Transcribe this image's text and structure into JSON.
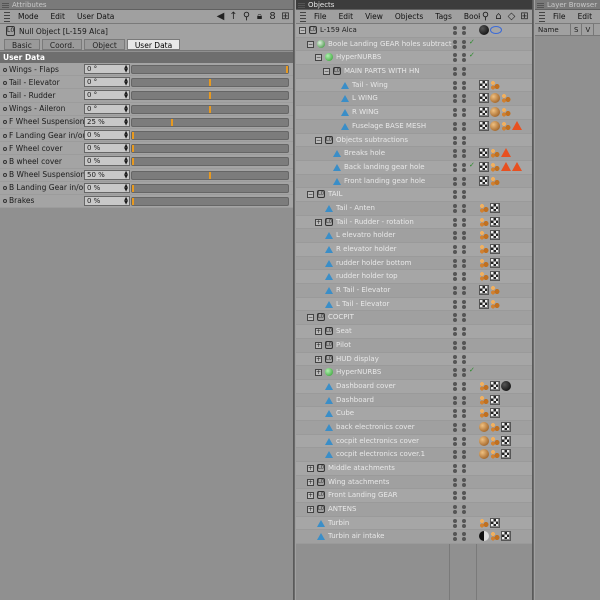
{
  "attributes": {
    "title": "Attributes",
    "menu": [
      "Mode",
      "Edit",
      "User Data"
    ],
    "object_title": "Null Object [L-159 Alca]",
    "tabs": [
      {
        "label": "Basic",
        "active": false
      },
      {
        "label": "Coord.",
        "active": false
      },
      {
        "label": "Object",
        "active": false
      },
      {
        "label": "User Data",
        "active": true
      }
    ],
    "section": "User Data",
    "rows": [
      {
        "label": "Wings - Flaps",
        "value": "0 °",
        "level": 1.0
      },
      {
        "label": "Tail - Elevator",
        "value": "0 °",
        "level": 0.5
      },
      {
        "label": "Tail - Rudder",
        "value": "0 °",
        "level": 0.5
      },
      {
        "label": "Wings - Aileron",
        "value": "0 °",
        "level": 0.5
      },
      {
        "label": "F Wheel Suspension",
        "value": "25 %",
        "level": 0.25
      },
      {
        "label": "F Landing Gear in/out",
        "value": "0 %",
        "level": 0.0
      },
      {
        "label": "F Wheel cover",
        "value": "0 %",
        "level": 0.0
      },
      {
        "label": "B wheel cover",
        "value": "0 %",
        "level": 0.0
      },
      {
        "label": "B Wheel Suspension",
        "value": "50 %",
        "level": 0.5
      },
      {
        "label": "B Landing Gear in/out",
        "value": "0 %",
        "level": 0.0
      },
      {
        "label": "Brakes",
        "value": "0 %",
        "level": 0.0
      }
    ],
    "colors": {
      "slider_marker": "#e89a20"
    }
  },
  "objects": {
    "title": "Objects",
    "menu": [
      "File",
      "Edit",
      "View",
      "Objects",
      "Tags",
      "Bookm"
    ],
    "rows": [
      {
        "name": "L-159 Alca",
        "depth": 0,
        "icon": "null",
        "expand": "-",
        "dim": false,
        "check": false,
        "tags": [
          "sphere",
          "target"
        ]
      },
      {
        "name": "Boole Landing GEAR holes subtract",
        "depth": 1,
        "icon": "boole",
        "expand": "-",
        "dim": true,
        "check": true,
        "tags": []
      },
      {
        "name": "HyperNURBS",
        "depth": 2,
        "icon": "hyper",
        "expand": "-",
        "dim": true,
        "check": true,
        "tags": []
      },
      {
        "name": "MAIN PARTS WITH HN",
        "depth": 3,
        "icon": "null",
        "expand": "-",
        "dim": true,
        "check": false,
        "tags": []
      },
      {
        "name": "Tail - Wing",
        "depth": 4,
        "icon": "tri",
        "expand": "",
        "dim": true,
        "check": false,
        "tags": [
          "checker",
          "phong"
        ]
      },
      {
        "name": "L WING",
        "depth": 4,
        "icon": "tri",
        "expand": "",
        "dim": true,
        "check": false,
        "tags": [
          "checker",
          "mat",
          "phong"
        ]
      },
      {
        "name": "R WING",
        "depth": 4,
        "icon": "tri",
        "expand": "",
        "dim": true,
        "check": false,
        "tags": [
          "checker",
          "mat",
          "phong"
        ]
      },
      {
        "name": "Fuselage BASE MESH",
        "depth": 4,
        "icon": "tri",
        "expand": "",
        "dim": true,
        "check": false,
        "tags": [
          "checker",
          "mat",
          "phong",
          "warn"
        ]
      },
      {
        "name": "Objects subtractions",
        "depth": 2,
        "icon": "null",
        "expand": "-",
        "dim": true,
        "check": false,
        "tags": []
      },
      {
        "name": "Breaks hole",
        "depth": 3,
        "icon": "tri",
        "expand": "",
        "dim": true,
        "check": false,
        "tags": [
          "checker",
          "phong",
          "warn"
        ]
      },
      {
        "name": "Back landing gear hole",
        "depth": 3,
        "icon": "tri",
        "expand": "",
        "dim": true,
        "check": true,
        "tags": [
          "checker",
          "phong",
          "warn",
          "warn"
        ]
      },
      {
        "name": "Front landing gear hole",
        "depth": 3,
        "icon": "tri",
        "expand": "",
        "dim": true,
        "check": false,
        "tags": [
          "checker",
          "phong"
        ]
      },
      {
        "name": "TAIL",
        "depth": 1,
        "icon": "null",
        "expand": "-",
        "dim": true,
        "check": false,
        "tags": []
      },
      {
        "name": "Tail - Anten",
        "depth": 2,
        "icon": "tri",
        "expand": "",
        "dim": true,
        "check": false,
        "tags": [
          "phong",
          "checker"
        ]
      },
      {
        "name": "Tail - Rudder - rotation",
        "depth": 2,
        "icon": "null",
        "expand": "+",
        "dim": true,
        "check": false,
        "tags": [
          "phong",
          "checker"
        ]
      },
      {
        "name": "L elevatro holder",
        "depth": 2,
        "icon": "tri",
        "expand": "",
        "dim": true,
        "check": false,
        "tags": [
          "phong",
          "checker"
        ]
      },
      {
        "name": "R elevator holder",
        "depth": 2,
        "icon": "tri",
        "expand": "",
        "dim": true,
        "check": false,
        "tags": [
          "phong",
          "checker"
        ]
      },
      {
        "name": "rudder holder bottom",
        "depth": 2,
        "icon": "tri",
        "expand": "",
        "dim": true,
        "check": false,
        "tags": [
          "phong",
          "checker"
        ]
      },
      {
        "name": "rudder holder top",
        "depth": 2,
        "icon": "tri",
        "expand": "",
        "dim": true,
        "check": false,
        "tags": [
          "phong",
          "checker"
        ]
      },
      {
        "name": "R Tail - Elevator",
        "depth": 2,
        "icon": "tri",
        "expand": "",
        "dim": true,
        "check": false,
        "tags": [
          "checker",
          "phong"
        ]
      },
      {
        "name": "L Tail - Elevator",
        "depth": 2,
        "icon": "tri",
        "expand": "",
        "dim": true,
        "check": false,
        "tags": [
          "checker",
          "phong"
        ]
      },
      {
        "name": "COCPIT",
        "depth": 1,
        "icon": "null",
        "expand": "-",
        "dim": true,
        "check": false,
        "tags": []
      },
      {
        "name": "Seat",
        "depth": 2,
        "icon": "null",
        "expand": "+",
        "dim": true,
        "check": false,
        "tags": []
      },
      {
        "name": "Pilot",
        "depth": 2,
        "icon": "null",
        "expand": "+",
        "dim": true,
        "check": false,
        "tags": []
      },
      {
        "name": "HUD display",
        "depth": 2,
        "icon": "null",
        "expand": "+",
        "dim": true,
        "check": false,
        "tags": []
      },
      {
        "name": "HyperNURBS",
        "depth": 2,
        "icon": "hyper",
        "expand": "+",
        "dim": true,
        "check": true,
        "tags": []
      },
      {
        "name": "Dashboard cover",
        "depth": 2,
        "icon": "tri",
        "expand": "",
        "dim": true,
        "check": false,
        "tags": [
          "phong",
          "checker",
          "sphere"
        ]
      },
      {
        "name": "Dashboard",
        "depth": 2,
        "icon": "tri",
        "expand": "",
        "dim": true,
        "check": false,
        "tags": [
          "phong",
          "checker"
        ]
      },
      {
        "name": "Cube",
        "depth": 2,
        "icon": "tri",
        "expand": "",
        "dim": true,
        "check": false,
        "tags": [
          "phong",
          "checker"
        ]
      },
      {
        "name": "back electronics cover",
        "depth": 2,
        "icon": "tri",
        "expand": "",
        "dim": true,
        "check": false,
        "tags": [
          "mat",
          "phong",
          "checker"
        ]
      },
      {
        "name": "cocpit electronics cover",
        "depth": 2,
        "icon": "tri",
        "expand": "",
        "dim": true,
        "check": false,
        "tags": [
          "mat",
          "phong",
          "checker"
        ]
      },
      {
        "name": "cocpit electronics cover.1",
        "depth": 2,
        "icon": "tri",
        "expand": "",
        "dim": true,
        "check": false,
        "tags": [
          "mat",
          "phong",
          "checker"
        ]
      },
      {
        "name": "Middle atachments",
        "depth": 1,
        "icon": "null",
        "expand": "+",
        "dim": true,
        "check": false,
        "tags": []
      },
      {
        "name": "Wing atachments",
        "depth": 1,
        "icon": "null",
        "expand": "+",
        "dim": true,
        "check": false,
        "tags": []
      },
      {
        "name": "Front Landing GEAR",
        "depth": 1,
        "icon": "null",
        "expand": "+",
        "dim": true,
        "check": false,
        "tags": []
      },
      {
        "name": "ANTENS",
        "depth": 1,
        "icon": "null",
        "expand": "+",
        "dim": true,
        "check": false,
        "tags": []
      },
      {
        "name": "Turbin",
        "depth": 1,
        "icon": "tri",
        "expand": "",
        "dim": true,
        "check": false,
        "tags": [
          "phong",
          "checker"
        ]
      },
      {
        "name": "Turbin air intake",
        "depth": 1,
        "icon": "tri",
        "expand": "",
        "dim": true,
        "check": false,
        "tags": [
          "half",
          "phong",
          "checker"
        ]
      }
    ]
  },
  "layers": {
    "title": "Layer Browser",
    "menu": [
      "File",
      "Edit"
    ],
    "columns": [
      "Name",
      "S",
      "V"
    ]
  }
}
